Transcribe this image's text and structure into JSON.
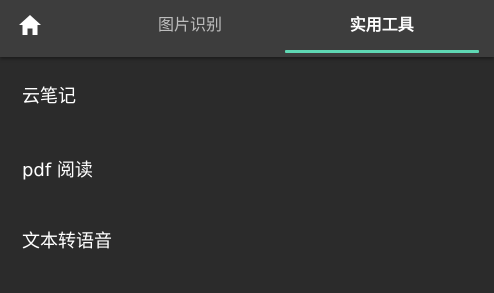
{
  "tabbar": {
    "home_icon": "home-icon",
    "tabs": [
      {
        "label": "图片识别",
        "active": false
      },
      {
        "label": "实用工具",
        "active": true
      }
    ],
    "indicator_color": "#5fd8b4"
  },
  "list": {
    "items": [
      {
        "label": "云笔记"
      },
      {
        "label": "pdf 阅读"
      },
      {
        "label": "文本转语音"
      }
    ]
  },
  "colors": {
    "background": "#2b2b2b",
    "tabbar_bg": "#3d3d3d",
    "active_text": "#ffffff",
    "inactive_text": "#bdbdbd"
  }
}
